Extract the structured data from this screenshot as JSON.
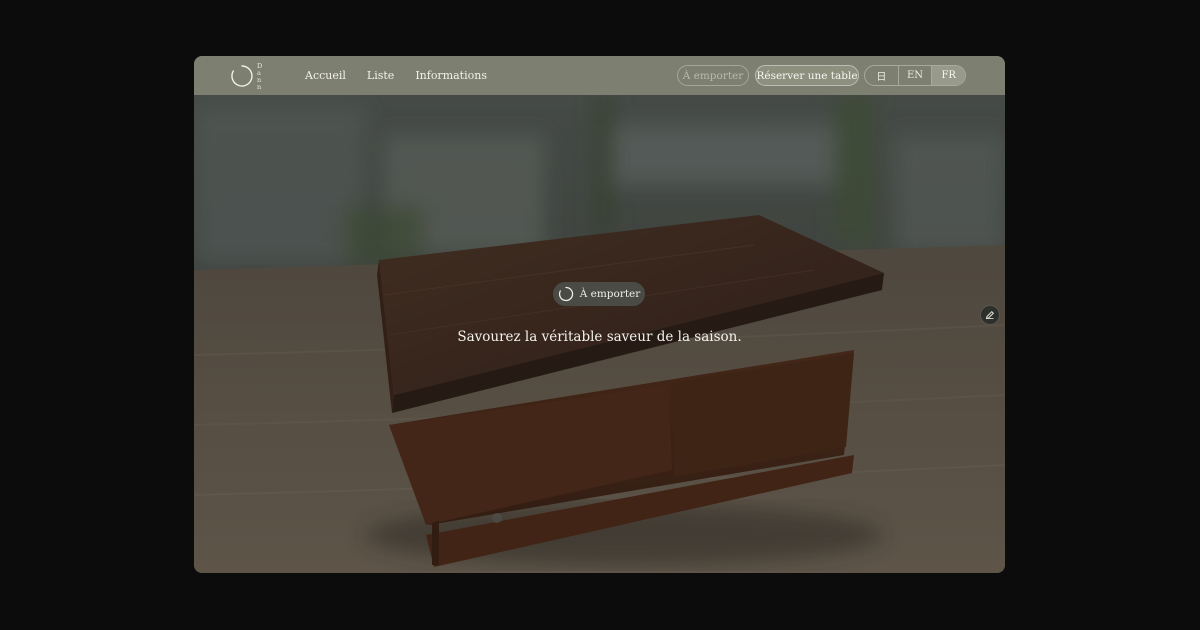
{
  "brand": {
    "logo_letters": [
      "D",
      "a",
      "n",
      "n"
    ]
  },
  "nav": {
    "items": [
      {
        "label": "Accueil"
      },
      {
        "label": "Liste"
      },
      {
        "label": "Informations"
      }
    ]
  },
  "actions": {
    "takeout_label": "À emporter",
    "reserve_label": "Réserver une table"
  },
  "languages": {
    "options": [
      "日",
      "EN",
      "FR"
    ],
    "selected": "FR"
  },
  "hero": {
    "badge_label": "À emporter",
    "tagline": "Savourez la véritable saveur de la saison."
  },
  "icons": {
    "logo": "circle-mark-icon",
    "badge": "loading-ring-icon",
    "edit": "pencil-icon"
  },
  "colors": {
    "header_bg": "#7d8070",
    "page_bg": "#0c0c0c",
    "accent_pill": "#8e907f"
  }
}
